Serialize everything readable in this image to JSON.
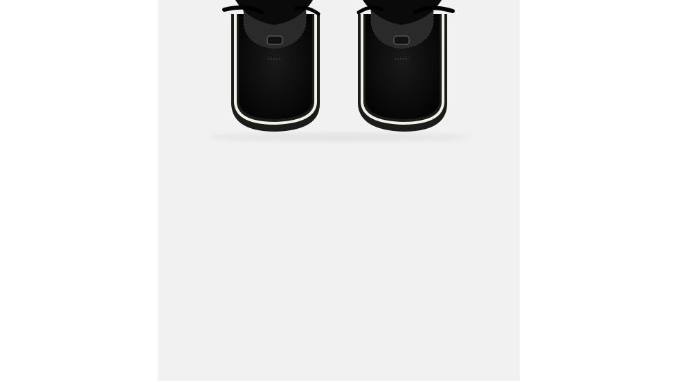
{
  "product_image": {
    "subject": "pair-of-black-suede-winter-boots-top-view",
    "background_color": "#f1f1f1",
    "boot_color": "#0e0e0e",
    "sole_color": "#1b1b1b",
    "welt_color": "#f2f1e6"
  }
}
